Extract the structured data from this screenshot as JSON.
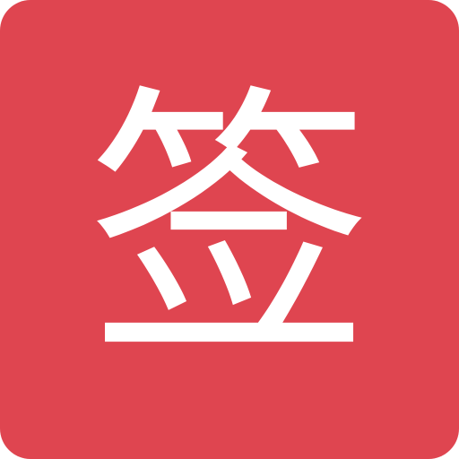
{
  "icon": {
    "glyph": "签",
    "background_color": "#df4550",
    "glyph_color": "#ffffff"
  }
}
